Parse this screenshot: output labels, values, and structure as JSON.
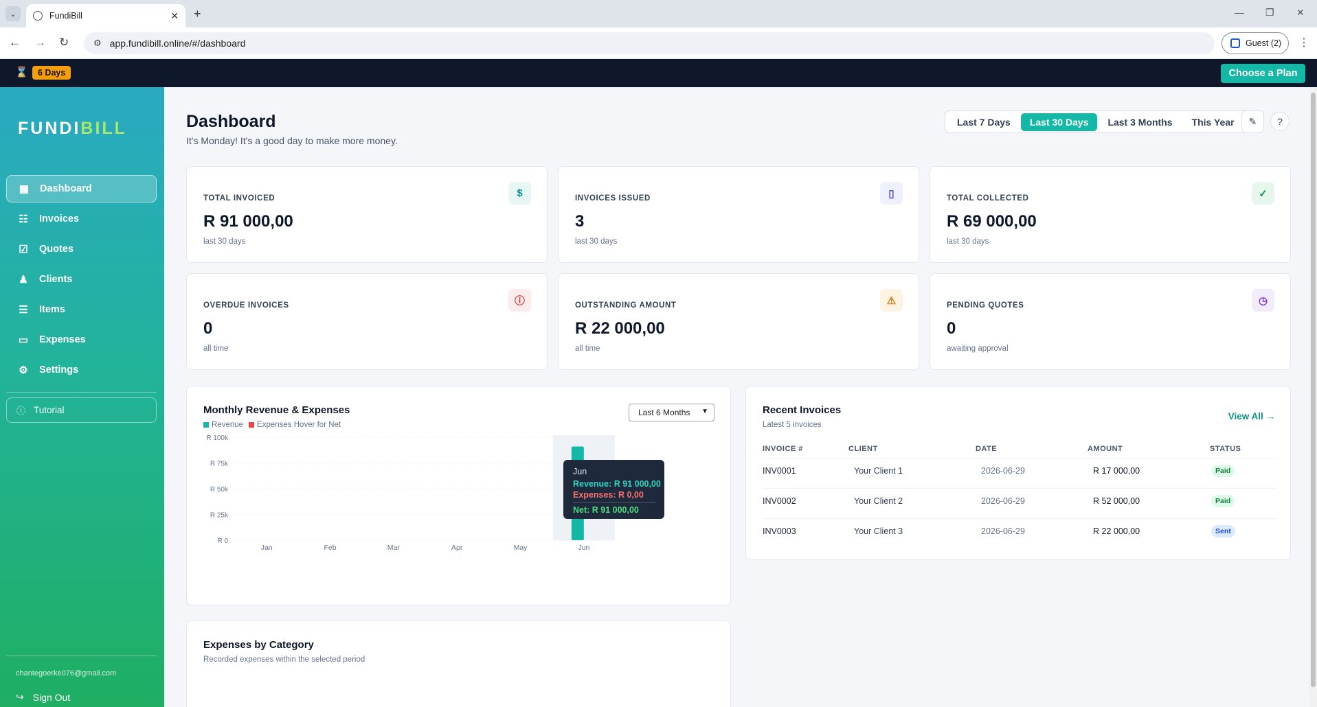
{
  "browser": {
    "tab_title": "FundiBill",
    "url": "app.fundibill.online/#/dashboard",
    "profile_label": "Guest (2)"
  },
  "trial": {
    "days_left": "6 Days",
    "cta": "Choose a Plan"
  },
  "sidebar": {
    "brand_part1": "FUNDI",
    "brand_part2": "BILL",
    "items": [
      {
        "label": "Dashboard",
        "icon": "grid-icon",
        "active": true
      },
      {
        "label": "Invoices",
        "icon": "document-icon"
      },
      {
        "label": "Quotes",
        "icon": "checkbox-icon"
      },
      {
        "label": "Clients",
        "icon": "users-icon"
      },
      {
        "label": "Items",
        "icon": "list-icon"
      },
      {
        "label": "Expenses",
        "icon": "credit-card-icon"
      },
      {
        "label": "Settings",
        "icon": "gear-icon"
      }
    ],
    "tutorial": "Tutorial",
    "email": "chantegoerke076@gmail.com",
    "signout": "Sign Out"
  },
  "header": {
    "title": "Dashboard",
    "subtitle": "It's Monday! It's a good day to make more money.",
    "ranges": [
      "Last 7 Days",
      "Last 30 Days",
      "Last 3 Months",
      "This Year"
    ],
    "selected_range": "Last 30 Days"
  },
  "stats": [
    {
      "label": "TOTAL INVOICED",
      "value": "R 91 000,00",
      "sub": "last 30 days",
      "icon": "dollar-icon",
      "icon_glyph": "$",
      "color": "#0d9488",
      "bg": "#e6f7f5"
    },
    {
      "label": "INVOICES ISSUED",
      "value": "3",
      "sub": "last 30 days",
      "icon": "file-icon",
      "icon_glyph": "▯",
      "color": "#4f46e5",
      "bg": "#eef0fb"
    },
    {
      "label": "TOTAL COLLECTED",
      "value": "R 69 000,00",
      "sub": "last 30 days",
      "icon": "check-icon",
      "icon_glyph": "✓",
      "color": "#059669",
      "bg": "#e7f7ee"
    },
    {
      "label": "OVERDUE INVOICES",
      "value": "0",
      "sub": "all time",
      "icon": "alert-circle-icon",
      "icon_glyph": "ⓘ",
      "color": "#dc2626",
      "bg": "#fdecec"
    },
    {
      "label": "OUTSTANDING AMOUNT",
      "value": "R 22 000,00",
      "sub": "all time",
      "icon": "warning-icon",
      "icon_glyph": "⚠",
      "color": "#d97706",
      "bg": "#fdf3e3"
    },
    {
      "label": "PENDING QUOTES",
      "value": "0",
      "sub": "awaiting approval",
      "icon": "clock-icon",
      "icon_glyph": "◷",
      "color": "#7c3aed",
      "bg": "#f2ecfd"
    }
  ],
  "revenue_card": {
    "title": "Monthly Revenue & Expenses",
    "legend_revenue": "Revenue",
    "legend_expenses": "Expenses Hover for Net",
    "select_value": "Last 6 Months",
    "tooltip": {
      "month": "Jun",
      "revenue": "Revenue: R 91 000,00",
      "expenses": "Expenses: R 0,00",
      "net": "Net: R 91 000,00"
    }
  },
  "chart_data": {
    "type": "bar",
    "title": "Monthly Revenue & Expenses",
    "categories": [
      "Jan",
      "Feb",
      "Mar",
      "Apr",
      "May",
      "Jun"
    ],
    "series": [
      {
        "name": "Revenue",
        "values": [
          0,
          0,
          0,
          0,
          0,
          91000
        ],
        "color": "#14b8a6"
      },
      {
        "name": "Expenses",
        "values": [
          0,
          0,
          0,
          0,
          0,
          0
        ],
        "color": "#ef4444"
      }
    ],
    "ylim": [
      0,
      100000
    ],
    "yticks": [
      0,
      25000,
      50000,
      75000,
      100000
    ],
    "ytick_labels": [
      "R 0",
      "R 25k",
      "R 50k",
      "R 75k",
      "R 100k"
    ],
    "highlighted_category": "Jun",
    "grid": true
  },
  "recent": {
    "title": "Recent Invoices",
    "subtitle": "Latest 5 invoices",
    "view_all": "View All →",
    "columns": [
      "INVOICE #",
      "CLIENT",
      "DATE",
      "AMOUNT",
      "STATUS"
    ],
    "rows": [
      {
        "invoice": "INV0001",
        "client": "Your Client 1",
        "date": "2026-06-29",
        "amount": "R 17 000,00",
        "status": "Paid"
      },
      {
        "invoice": "INV0002",
        "client": "Your Client 2",
        "date": "2026-06-29",
        "amount": "R 52 000,00",
        "status": "Paid"
      },
      {
        "invoice": "INV0003",
        "client": "Your Client 3",
        "date": "2026-06-29",
        "amount": "R 22 000,00",
        "status": "Sent"
      }
    ]
  },
  "expenses_card": {
    "title": "Expenses by Category",
    "subtitle": "Recorded expenses within the selected period"
  }
}
